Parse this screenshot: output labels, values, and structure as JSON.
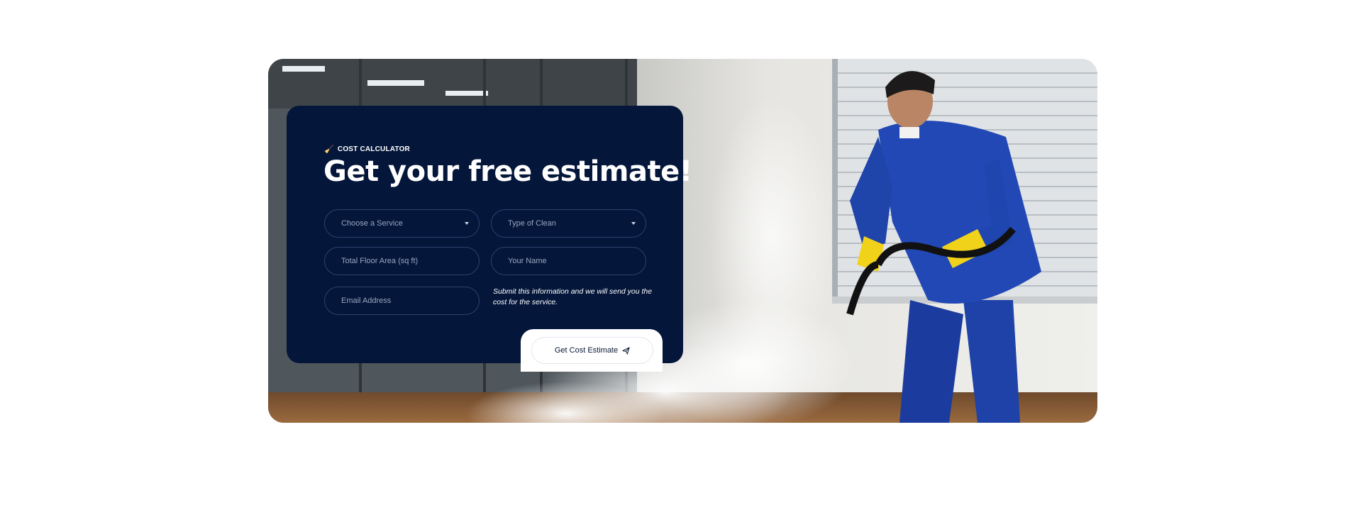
{
  "estimate_form": {
    "eyebrow": "COST CALCULATOR",
    "eyebrow_icon": "broom-icon",
    "title": "Get your free estimate!",
    "service_select": {
      "placeholder": "Choose a Service"
    },
    "clean_type_select": {
      "placeholder": "Type of Clean"
    },
    "floor_area_input": {
      "placeholder": "Total Floor Area (sq ft)"
    },
    "name_input": {
      "placeholder": "Your Name"
    },
    "email_input": {
      "placeholder": "Email Address"
    },
    "note": "Submit this information and we will send you the cost for the service.",
    "submit_label": "Get Cost Estimate",
    "submit_icon": "paper-plane-icon"
  },
  "hero_image": {
    "subject": "cleaning-worker-with-steam-vacuum",
    "colors": {
      "uniform": "#1e3fa8",
      "gloves": "#f1d21a",
      "machine_lid": "#d4141f",
      "machine_body": "#2d6fbf"
    }
  },
  "colors": {
    "card_background": "#04163a",
    "field_border": "#2d426e",
    "accent": "#f5b600"
  }
}
